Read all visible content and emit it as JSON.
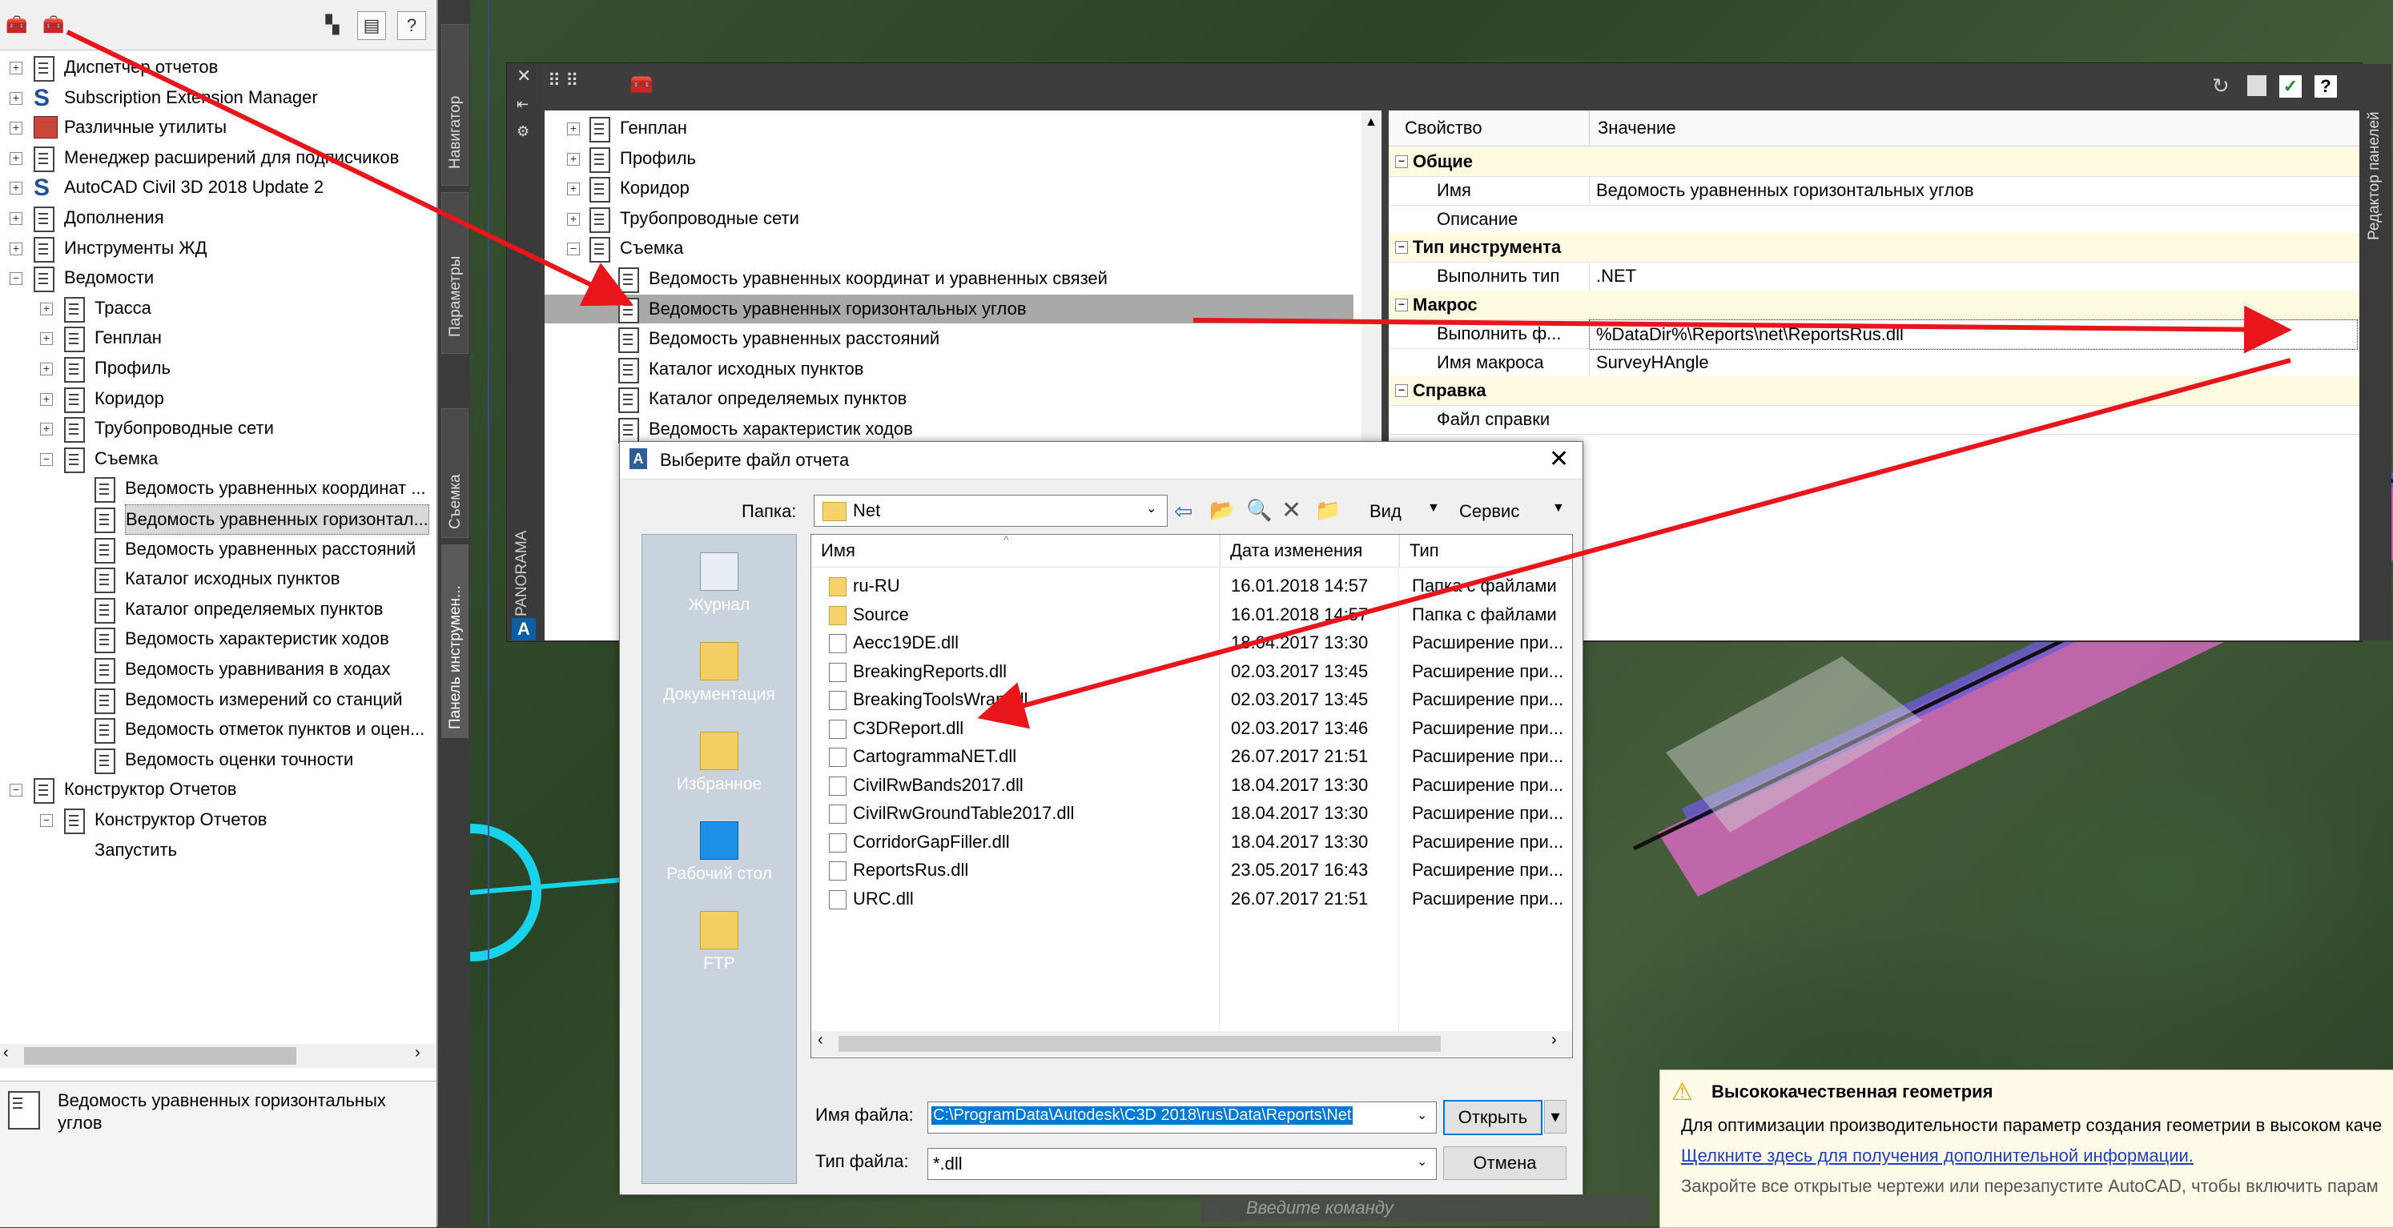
{
  "left_panel": {
    "tree": [
      {
        "label": "Диспетчер отчетов",
        "icon": "report-icon"
      },
      {
        "label": "Subscription Extension Manager",
        "icon": "s-icon"
      },
      {
        "label": "Различные утилиты",
        "icon": "toolbox-icon"
      },
      {
        "label": "Менеджер расширений для подписчиков",
        "icon": "report-icon"
      },
      {
        "label": "AutoCAD Civil 3D 2018 Update 2",
        "icon": "s-icon"
      },
      {
        "label": "Дополнения",
        "icon": "report-icon"
      },
      {
        "label": "Инструменты ЖД",
        "icon": "report-icon"
      },
      {
        "label": "Ведомости",
        "icon": "report-icon"
      },
      {
        "label": "Трасса",
        "icon": "report-icon"
      },
      {
        "label": "Генплан",
        "icon": "report-icon"
      },
      {
        "label": "Профиль",
        "icon": "report-icon"
      },
      {
        "label": "Коридор",
        "icon": "report-icon"
      },
      {
        "label": "Трубопроводные сети",
        "icon": "report-icon"
      },
      {
        "label": "Съемка",
        "icon": "report-icon"
      },
      {
        "label": "Ведомость уравненных координат ...",
        "icon": "report-icon"
      },
      {
        "label": "Ведомость уравненных горизонтал...",
        "icon": "report-icon"
      },
      {
        "label": "Ведомость уравненных расстояний",
        "icon": "report-icon"
      },
      {
        "label": "Каталог исходных пунктов",
        "icon": "report-icon"
      },
      {
        "label": "Каталог определяемых пунктов",
        "icon": "report-icon"
      },
      {
        "label": "Ведомость характеристик ходов",
        "icon": "report-icon"
      },
      {
        "label": "Ведомость уравнивания в ходах",
        "icon": "report-icon"
      },
      {
        "label": "Ведомость измерений со станций",
        "icon": "report-icon"
      },
      {
        "label": "Ведомость отметок пунктов и оцен...",
        "icon": "report-icon"
      },
      {
        "label": "Ведомость оценки точности",
        "icon": "report-icon"
      },
      {
        "label": "Конструктор Отчетов",
        "icon": "report-icon"
      },
      {
        "label": "Конструктор Отчетов",
        "icon": "report-icon"
      },
      {
        "label": "Запустить",
        "icon": ""
      }
    ],
    "info_text": "Ведомость уравненных горизонтальных углов"
  },
  "vertical_tabs": [
    "Навигатор",
    "Параметры",
    "Съемка",
    "Панель инструмен..."
  ],
  "panorama": {
    "label": "PANORAMA"
  },
  "top_palette": {
    "tree": [
      "Генплан",
      "Профиль",
      "Коридор",
      "Трубопроводные сети",
      "Съемка",
      "Ведомость уравненных координат и уравненных связей",
      "Ведомость уравненных горизонтальных углов",
      "Ведомость уравненных расстояний",
      "Каталог исходных пунктов",
      "Каталог определяемых пунктов",
      "Ведомость характеристик ходов"
    ],
    "props_header": {
      "name": "Свойство",
      "value": "Значение"
    },
    "props": [
      {
        "cat": true,
        "name": "Общие",
        "value": ""
      },
      {
        "cat": false,
        "name": "Имя",
        "value": "Ведомость уравненных горизонтальных углов"
      },
      {
        "cat": false,
        "name": "Описание",
        "value": ""
      },
      {
        "cat": true,
        "name": "Тип инструмента",
        "value": ""
      },
      {
        "cat": false,
        "name": "Выполнить тип",
        "value": ".NET"
      },
      {
        "cat": true,
        "name": "Макрос",
        "value": ""
      },
      {
        "cat": false,
        "name": "Выполнить ф...",
        "value": "%DataDir%\\Reports\\net\\ReportsRus.dll"
      },
      {
        "cat": false,
        "name": "Имя макроса",
        "value": "SurveyHAngle"
      },
      {
        "cat": true,
        "name": "Справка",
        "value": ""
      },
      {
        "cat": false,
        "name": "Файл справки",
        "value": ""
      }
    ],
    "side_tab": "Редактор панелей"
  },
  "dialog": {
    "title": "Выберите файл отчета",
    "folder_label": "Папка:",
    "folder_value": "Net",
    "view_label": "Вид",
    "service_label": "Сервис",
    "places": [
      "Журнал",
      "Документация",
      "Избранное",
      "Рабочий стол",
      "FTP"
    ],
    "columns": {
      "name": "Имя",
      "date": "Дата изменения",
      "type": "Тип"
    },
    "files": [
      {
        "name": "ru-RU",
        "date": "16.01.2018 14:57",
        "type": "Папка с файлами",
        "kind": "folder"
      },
      {
        "name": "Source",
        "date": "16.01.2018 14:57",
        "type": "Папка с файлами",
        "kind": "folder"
      },
      {
        "name": "Aecc19DE.dll",
        "date": "18.04.2017 13:30",
        "type": "Расширение при...",
        "kind": "dll"
      },
      {
        "name": "BreakingReports.dll",
        "date": "02.03.2017 13:45",
        "type": "Расширение при...",
        "kind": "dll"
      },
      {
        "name": "BreakingToolsWrap.dll",
        "date": "02.03.2017 13:45",
        "type": "Расширение при...",
        "kind": "dll"
      },
      {
        "name": "C3DReport.dll",
        "date": "02.03.2017 13:46",
        "type": "Расширение при...",
        "kind": "dll"
      },
      {
        "name": "CartogrammaNET.dll",
        "date": "26.07.2017 21:51",
        "type": "Расширение при...",
        "kind": "dll"
      },
      {
        "name": "CivilRwBands2017.dll",
        "date": "18.04.2017 13:30",
        "type": "Расширение при...",
        "kind": "dll"
      },
      {
        "name": "CivilRwGroundTable2017.dll",
        "date": "18.04.2017 13:30",
        "type": "Расширение при...",
        "kind": "dll"
      },
      {
        "name": "CorridorGapFiller.dll",
        "date": "18.04.2017 13:30",
        "type": "Расширение при...",
        "kind": "dll"
      },
      {
        "name": "ReportsRus.dll",
        "date": "23.05.2017 16:43",
        "type": "Расширение при...",
        "kind": "dll"
      },
      {
        "name": "URC.dll",
        "date": "26.07.2017 21:51",
        "type": "Расширение при...",
        "kind": "dll"
      }
    ],
    "filename_label": "Имя файла:",
    "filename_value": "C:\\ProgramData\\Autodesk\\C3D 2018\\rus\\Data\\Reports\\Net",
    "filetype_label": "Тип файла:",
    "filetype_value": "*.dll",
    "open_label": "Открыть",
    "cancel_label": "Отмена"
  },
  "notification": {
    "title": "Высококачественная геометрия",
    "line1": "Для оптимизации производительности параметр создания геометрии в высоком каче",
    "link": "Щелкните здесь для получения дополнительной информации.",
    "line3": "Закройте все открытые чертежи или перезапустите AutoCAD, чтобы включить парам"
  },
  "command_line": {
    "placeholder": "Введите команду"
  },
  "colors": {
    "accent": "#0078d7",
    "arrow": "#e8151b",
    "selection": "#d9d9d9",
    "notif_bg": "#fffbe8"
  }
}
